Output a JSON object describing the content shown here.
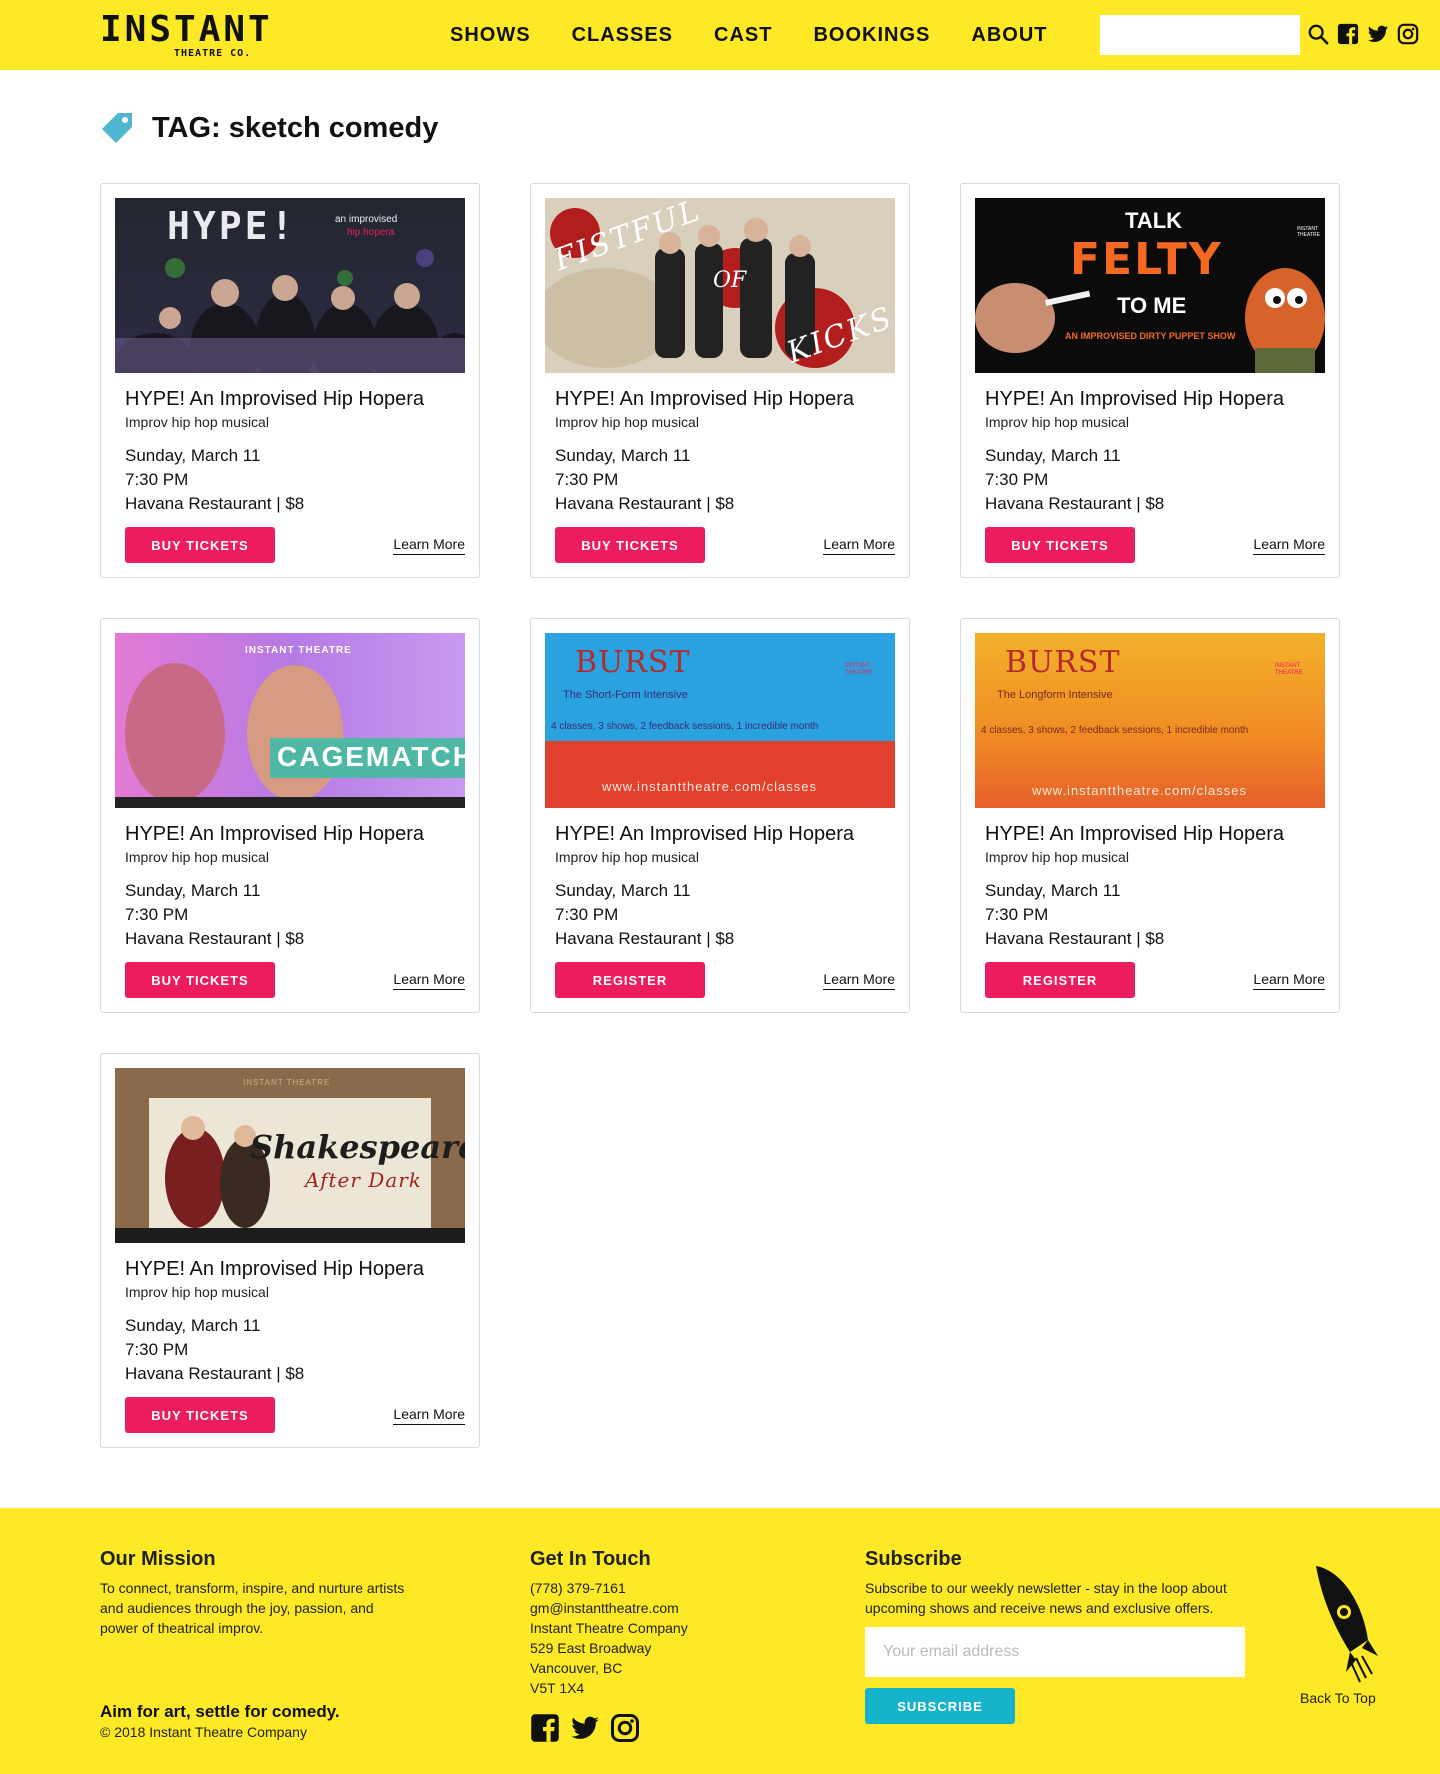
{
  "header": {
    "logo_word": "INSTANT",
    "logo_sub": "THEATRE CO.",
    "nav": [
      "SHOWS",
      "CLASSES",
      "CAST",
      "BOOKINGS",
      "ABOUT"
    ],
    "search_placeholder": ""
  },
  "page": {
    "tag_title": "TAG: sketch comedy"
  },
  "cards": [
    {
      "image": "HYPE! an improvised hip hopera",
      "title": "HYPE! An Improvised Hip Hopera",
      "subtitle": "Improv hip hop musical",
      "date": "Sunday, March 11",
      "time": "7:30 PM",
      "venue": "Havana Restaurant | $8",
      "button": "BUY TICKETS",
      "learn": "Learn More"
    },
    {
      "image": "Fistful of Kicks",
      "title": "HYPE! An Improvised Hip Hopera",
      "subtitle": "Improv hip hop musical",
      "date": "Sunday, March 11",
      "time": "7:30 PM",
      "venue": "Havana Restaurant | $8",
      "button": "BUY TICKETS",
      "learn": "Learn More"
    },
    {
      "image": "Talk Felty To Me",
      "title": "HYPE! An Improvised Hip Hopera",
      "subtitle": "Improv hip hop musical",
      "date": "Sunday, March 11",
      "time": "7:30 PM",
      "venue": "Havana Restaurant | $8",
      "button": "BUY TICKETS",
      "learn": "Learn More"
    },
    {
      "image": "Cagematch",
      "title": "HYPE! An Improvised Hip Hopera",
      "subtitle": "Improv hip hop musical",
      "date": "Sunday, March 11",
      "time": "7:30 PM",
      "venue": "Havana Restaurant | $8",
      "button": "BUY TICKETS",
      "learn": "Learn More"
    },
    {
      "image": "Burst Short-Form",
      "title": "HYPE! An Improvised Hip Hopera",
      "subtitle": "Improv hip hop musical",
      "date": "Sunday, March 11",
      "time": "7:30 PM",
      "venue": "Havana Restaurant | $8",
      "button": "REGISTER",
      "learn": "Learn More"
    },
    {
      "image": "Burst Longform",
      "title": "HYPE! An Improvised Hip Hopera",
      "subtitle": "Improv hip hop musical",
      "date": "Sunday, March 11",
      "time": "7:30 PM",
      "venue": "Havana Restaurant | $8",
      "button": "REGISTER",
      "learn": "Learn More"
    },
    {
      "image": "Shakespeare After Dark",
      "title": "HYPE! An Improvised Hip Hopera",
      "subtitle": "Improv hip hop musical",
      "date": "Sunday, March 11",
      "time": "7:30 PM",
      "venue": "Havana Restaurant | $8",
      "button": "BUY TICKETS",
      "learn": "Learn More"
    }
  ],
  "images": {
    "hype": {
      "big": "HYPE!",
      "small1": "an improvised",
      "small2": "hip hopera"
    },
    "fistful": {
      "w1": "FISTFUL",
      "w2": "OF",
      "w3": "KICKS"
    },
    "felty": {
      "w1": "TALK",
      "w2": "FELTY",
      "w3": "TO ME",
      "w4": "AN IMPROVISED DIRTY PUPPET SHOW",
      "brand": "INSTANT THEATRE"
    },
    "cage": {
      "brand": "INSTANT THEATRE",
      "word": "CAGEMATCH"
    },
    "burst1": {
      "word": "BURST",
      "sub": "The Short-Form Intensive",
      "line": "4 classes, 3 shows, 2 feedback sessions, 1 incredible month",
      "url": "www.instanttheatre.com/classes",
      "brand": "INSTANT THEATRE"
    },
    "burst2": {
      "word": "BURST",
      "sub": "The Longform Intensive",
      "line": "4 classes, 3 shows, 2 feedback sessions, 1 incredible month",
      "url": "www.instanttheatre.com/classes",
      "brand": "INSTANT THEATRE"
    },
    "shakes": {
      "brand": "INSTANT THEATRE",
      "w1": "Shakespeare",
      "w2": "After Dark"
    }
  },
  "footer": {
    "mission_head": "Our Mission",
    "mission_text": "To connect, transform, inspire, and nurture artists and audiences through the joy, passion, and power of theatrical improv.",
    "tagline": "Aim for art, settle for comedy.",
    "copyright": "© 2018 Instant Theatre Company",
    "touch_head": "Get In Touch",
    "touch_lines": [
      "(778) 379-7161",
      "gm@instanttheatre.com",
      "Instant Theatre Company",
      "529 East Broadway",
      "Vancouver, BC",
      "V5T 1X4"
    ],
    "subscribe_head": "Subscribe",
    "subscribe_text": "Subscribe to our weekly newsletter - stay in the loop about upcoming shows and receive news and exclusive offers.",
    "email_placeholder": "Your email address",
    "subscribe_button": "SUBSCRIBE",
    "back_to_top": "Back To Top"
  },
  "colors": {
    "brand_yellow": "#fde925",
    "button_pink": "#ec1c5e",
    "subscribe_teal": "#17b3cb",
    "tag_teal": "#4fb6d0"
  },
  "icons": [
    "search-icon",
    "facebook-icon",
    "twitter-icon",
    "instagram-icon",
    "tag-icon",
    "rocket-icon"
  ]
}
